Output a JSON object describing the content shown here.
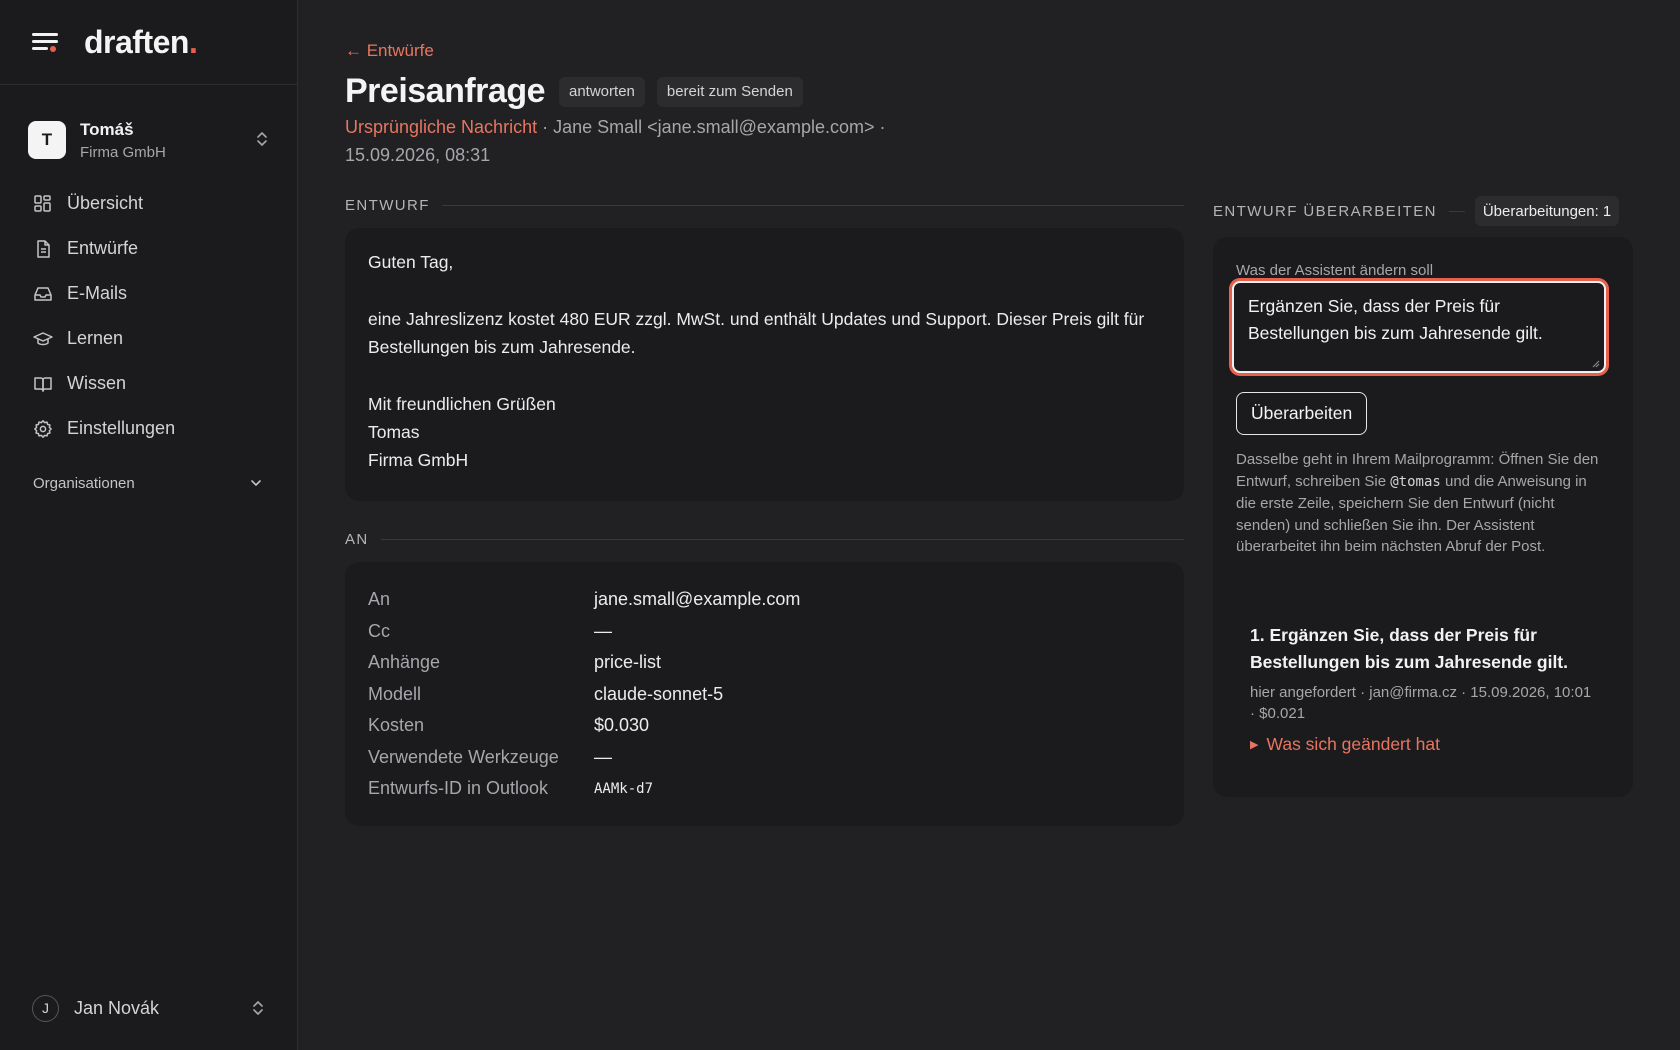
{
  "brand": {
    "name": "draften",
    "dot": "."
  },
  "org": {
    "initial": "T",
    "name": "Tomáš",
    "company": "Firma GmbH"
  },
  "nav": {
    "items": [
      {
        "label": "Übersicht",
        "icon": "grid-icon"
      },
      {
        "label": "Entwürfe",
        "icon": "document-icon"
      },
      {
        "label": "E-Mails",
        "icon": "inbox-icon"
      },
      {
        "label": "Lernen",
        "icon": "graduation-cap-icon"
      },
      {
        "label": "Wissen",
        "icon": "book-icon"
      },
      {
        "label": "Einstellungen",
        "icon": "gear-icon"
      }
    ],
    "section": "Organisationen"
  },
  "user": {
    "initial": "J",
    "name": "Jan Novák"
  },
  "page": {
    "back": "← Entwürfe",
    "title": "Preisanfrage",
    "badges": [
      "antworten",
      "bereit zum Senden"
    ],
    "orig_link": "Ursprüngliche Nachricht",
    "meta_rest": " · Jane Small <jane.small@example.com> · 15.09.2026, 08:31"
  },
  "draft": {
    "label": "ENTWURF",
    "greeting": "Guten Tag,",
    "body": "eine Jahreslizenz kostet 480 EUR zzgl. MwSt. und enthält Updates und Support. Dieser Preis gilt für Bestellungen bis zum Jahresende.",
    "closing": "Mit freundlichen Grüßen",
    "sig_name": "Tomas",
    "sig_company": "Firma GmbH"
  },
  "details": {
    "label": "AN",
    "rows": [
      {
        "key": "An",
        "value": "jane.small@example.com"
      },
      {
        "key": "Cc",
        "value": "—"
      },
      {
        "key": "Anhänge",
        "value": "price-list"
      },
      {
        "key": "Modell",
        "value": "claude-sonnet-5"
      },
      {
        "key": "Kosten",
        "value": "$0.030"
      },
      {
        "key": "Verwendete Werkzeuge",
        "value": "—"
      },
      {
        "key": "Entwurfs-ID in Outlook",
        "value": "AAMk-d7"
      }
    ]
  },
  "revise": {
    "label": "ENTWURF ÜBERARBEITEN",
    "count": "Überarbeitungen: 1",
    "field_label": "Was der Assistent ändern soll",
    "input_value": "Ergänzen Sie, dass der Preis für Bestellungen bis zum Jahresende gilt.",
    "button": "Überarbeiten",
    "help_1": "Dasselbe geht in Ihrem Mailprogramm: Öffnen Sie den Entwurf, schreiben Sie ",
    "help_code": "@tomas",
    "help_2": " und die Anweisung in die erste Zeile, speichern Sie den Entwurf (nicht senden) und schließen Sie ihn. Der Assistent überarbeitet ihn beim nächsten Abruf der Post.",
    "history": [
      {
        "title": "1. Ergänzen Sie, dass der Preis für Bestellungen bis zum Jahresende gilt.",
        "meta": "hier angefordert · jan@firma.cz · 15.09.2026, 10:01 · $0.021",
        "toggle": "Was sich geändert hat"
      }
    ]
  },
  "colors": {
    "accent": "#e8604c",
    "link": "#e8755f",
    "bg": "#212124",
    "sidebar": "#1b1b1d"
  }
}
